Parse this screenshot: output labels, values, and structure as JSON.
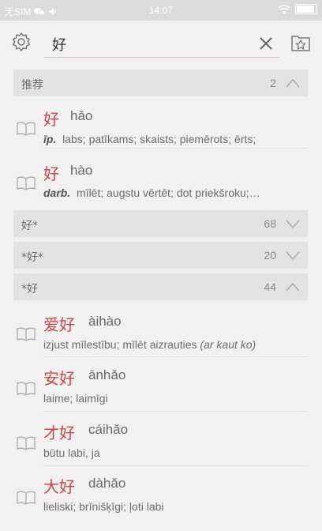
{
  "status": {
    "carrier": "无SIM",
    "time": "14:07"
  },
  "search": {
    "value": "好"
  },
  "sections": [
    {
      "title": "推荐",
      "count": "2",
      "expanded": true
    },
    {
      "title": "好*",
      "count": "68",
      "expanded": false
    },
    {
      "title": "*好*",
      "count": "20",
      "expanded": false
    },
    {
      "title": "*好",
      "count": "44",
      "expanded": true
    }
  ],
  "recommended": [
    {
      "hanzi": "好",
      "pinyin": "hǎo",
      "pos": "īp.",
      "def": "labs; patīkams; skaists; piemērots; ērts;"
    },
    {
      "hanzi": "好",
      "pinyin": "hào",
      "pos": "darb.",
      "def": "mīlēt; augstu vērtēt; dot priekšroku;…"
    }
  ],
  "suffix_entries": [
    {
      "hanzi": "爱好",
      "pinyin": "àihào",
      "def": "izjust mīlestību; mīlēt aizrauties ",
      "note": "(ar kaut ko)"
    },
    {
      "hanzi": "安好",
      "pinyin": "ānhǎo",
      "def": "laime; laimīgi",
      "note": ""
    },
    {
      "hanzi": "才好",
      "pinyin": "cáihǎo",
      "def": "būtu labi, ja",
      "note": ""
    },
    {
      "hanzi": "大好",
      "pinyin": "dàhǎo",
      "def": "lieliski; brīnišķīgi; ļoti labi",
      "note": ""
    }
  ],
  "colors": {
    "hanzi": "#c8484a",
    "section_bg": "#e4e2e2",
    "background": "#f2f0f0"
  },
  "icons": {
    "settings": "gear-icon",
    "clear": "close-icon",
    "favorites": "star-folder-icon",
    "entry": "book-icon"
  }
}
